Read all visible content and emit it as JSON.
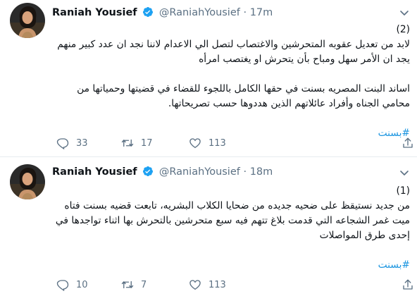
{
  "tweets": [
    {
      "display_name": "Raniah Yousief",
      "handle": "@RaniahYousief",
      "separator": "·",
      "time": "17m",
      "text": "(2)\nلابد من تعديل عقوبه المتحرشين والاغتصاب لتصل الي الاعدام لاننا نجد ان عدد كبير منهم يجد ان الأمر سهل ومباح بأن يتحرش او يغتصب امرأه\n\nاساند البنت المصريه بسنت في حقها الكامل باللجوء للقضاء في قضيتها وحمياتها من محامي الجناه وأفراد عائلاتهم الذين هددوها حسب تصريحاتها.",
      "hashtag": "#بسنت",
      "replies": "33",
      "retweets": "17",
      "likes": "113"
    },
    {
      "display_name": "Raniah Yousief",
      "handle": "@RaniahYousief",
      "separator": "·",
      "time": "18m",
      "text": "(1)\nمن جديد نستيقظ على ضحيه جديده من ضحايا الكلاب البشريه، تابعت قضيه بسنت فتاه ميت غمر الشجاعه التي قدمت بلاغ تتهم فيه سبع متحرشين بالتحرش بها اثناء تواجدها في إحدى طرق المواصلات",
      "hashtag": "#بسنت",
      "replies": "10",
      "retweets": "7",
      "likes": "113"
    }
  ],
  "colors": {
    "accent": "#1b95e0",
    "muted": "#5b7083",
    "text": "#0f1419",
    "divider": "#e6ecf0"
  },
  "icons": [
    "avatar",
    "verified-icon",
    "chevron-down-icon",
    "reply-icon",
    "retweet-icon",
    "like-icon",
    "share-icon"
  ]
}
